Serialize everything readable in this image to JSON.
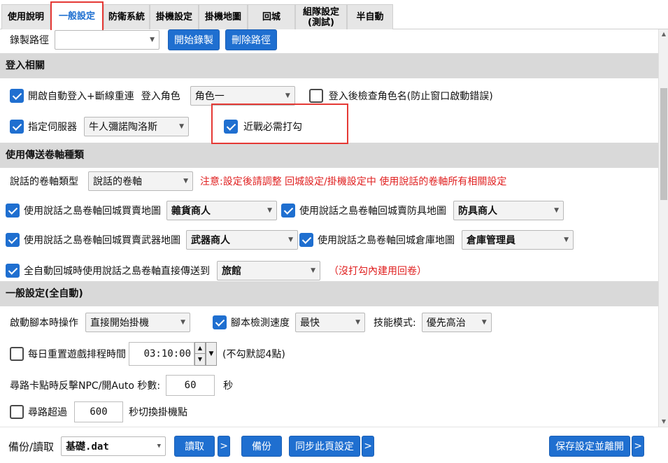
{
  "tabs": [
    {
      "label": "使用說明"
    },
    {
      "label": "一般設定"
    },
    {
      "label": "防衛系統"
    },
    {
      "label": "掛機設定"
    },
    {
      "label": "掛機地圖"
    },
    {
      "label": "回城"
    },
    {
      "label": "組隊設定\n(測試)"
    },
    {
      "label": "半自動"
    }
  ],
  "record": {
    "label": "錄製路徑",
    "path_value": "",
    "start_button": "開始錄製",
    "delete_button": "刪除路徑"
  },
  "login_section": {
    "title": "登入相關",
    "auto_login": {
      "label": "開啟自動登入+斷線重連",
      "checked": true
    },
    "login_role_label": "登入角色",
    "login_role_value": "角色一",
    "check_role_name": {
      "label": "登入後檢查角色名(防止窗口啟動錯誤)",
      "checked": false
    },
    "specify_server": {
      "label": "指定伺服器",
      "checked": true
    },
    "server_value": "牛人彌諾陶洛斯",
    "melee_required": {
      "label": "近戰必需打勾",
      "checked": true
    }
  },
  "scroll_section": {
    "title": "使用傳送卷軸種類",
    "scroll_type_label": "說話的卷軸類型",
    "scroll_type_value": "說話的卷軸",
    "notice": "注意:設定後請調整 回城設定/掛機設定中 使用說話的卷軸所有相關設定",
    "buy_sell_map": {
      "label": "使用說話之島卷軸回城買賣地圖",
      "checked": true,
      "value": "雜貨商人"
    },
    "sell_armor_map": {
      "label": "使用說話之島卷軸回城賣防具地圖",
      "checked": true,
      "value": "防具商人"
    },
    "buy_sell_weapon_map": {
      "label": "使用說話之島卷軸回城買賣武器地圖",
      "checked": true,
      "value": "武器商人"
    },
    "warehouse_map": {
      "label": "使用說話之島卷軸回城倉庫地圖",
      "checked": true,
      "value": "倉庫管理員"
    },
    "direct_teleport": {
      "label": "全自動回城時使用說話之島卷軸直接傳送到",
      "checked": true,
      "value": "旅館"
    },
    "direct_teleport_note": "（沒打勾內建用回卷）"
  },
  "general_section": {
    "title": "一般設定(全自動)",
    "startup_label": "啟動腳本時操作",
    "startup_value": "直接開始掛機",
    "detect_speed": {
      "label": "腳本檢測速度",
      "checked": true,
      "value": "最快"
    },
    "skill_mode_label": "技能模式:",
    "skill_mode_value": "優先高治",
    "daily_reset": {
      "label": "每日重置遊戲排程時間",
      "checked": false,
      "time": "03:10:00",
      "note": "(不勾默認4點)"
    },
    "counter_label": "尋路卡點時反擊NPC/開Auto 秒數:",
    "counter_value": "60",
    "counter_unit": "秒",
    "path_timeout": {
      "label": "尋路超過",
      "checked": false,
      "value": "600",
      "suffix": "秒切換掛機點"
    }
  },
  "footer": {
    "backup_label": "備份/讀取",
    "backup_file": "基礎.dat",
    "read_button": "讀取",
    "more_1": ">",
    "backup_button": "備份",
    "sync_button": "同步此頁設定",
    "more_2": ">",
    "save_exit_button": "保存設定並離開",
    "more_3": ">"
  },
  "colors": {
    "accent": "#1f6fd0",
    "section_bg": "#d9d9d9",
    "warning": "#e02020",
    "highlight_border": "#e53935"
  }
}
